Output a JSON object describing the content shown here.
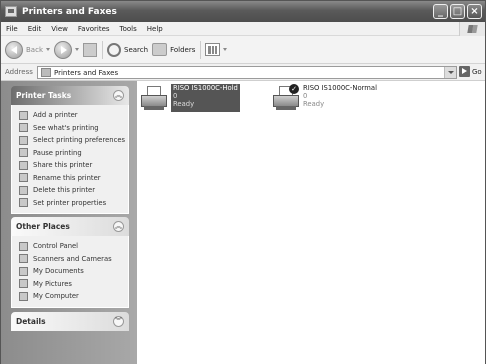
{
  "window": {
    "title": "Printers and Faxes"
  },
  "menu": [
    "File",
    "Edit",
    "View",
    "Favorites",
    "Tools",
    "Help"
  ],
  "toolbar": {
    "back_label": "Back",
    "search_label": "Search",
    "folders_label": "Folders"
  },
  "address": {
    "label": "Address",
    "value": "Printers and Faxes",
    "go_label": "Go"
  },
  "printer_tasks": {
    "title": "Printer Tasks",
    "items": [
      {
        "label": "Add a printer",
        "icon": "add-printer-icon"
      },
      {
        "label": "See what's printing",
        "icon": "print-queue-icon"
      },
      {
        "label": "Select printing preferences",
        "icon": "preferences-icon"
      },
      {
        "label": "Pause printing",
        "icon": "pause-icon"
      },
      {
        "label": "Share this printer",
        "icon": "share-icon"
      },
      {
        "label": "Rename this printer",
        "icon": "rename-icon"
      },
      {
        "label": "Delete this printer",
        "icon": "delete-icon"
      },
      {
        "label": "Set printer properties",
        "icon": "properties-icon"
      }
    ]
  },
  "other_places": {
    "title": "Other Places",
    "items": [
      {
        "label": "Control Panel",
        "icon": "control-panel-icon"
      },
      {
        "label": "Scanners and Cameras",
        "icon": "scanner-icon"
      },
      {
        "label": "My Documents",
        "icon": "folder-icon"
      },
      {
        "label": "My Pictures",
        "icon": "pictures-icon"
      },
      {
        "label": "My Computer",
        "icon": "computer-icon"
      }
    ]
  },
  "details": {
    "title": "Details"
  },
  "printers": [
    {
      "name": "RISO IS1000C-Hold",
      "count": "0",
      "status": "Ready"
    },
    {
      "name": "RISO IS1000C-Normal",
      "count": "0",
      "status": "Ready"
    }
  ]
}
